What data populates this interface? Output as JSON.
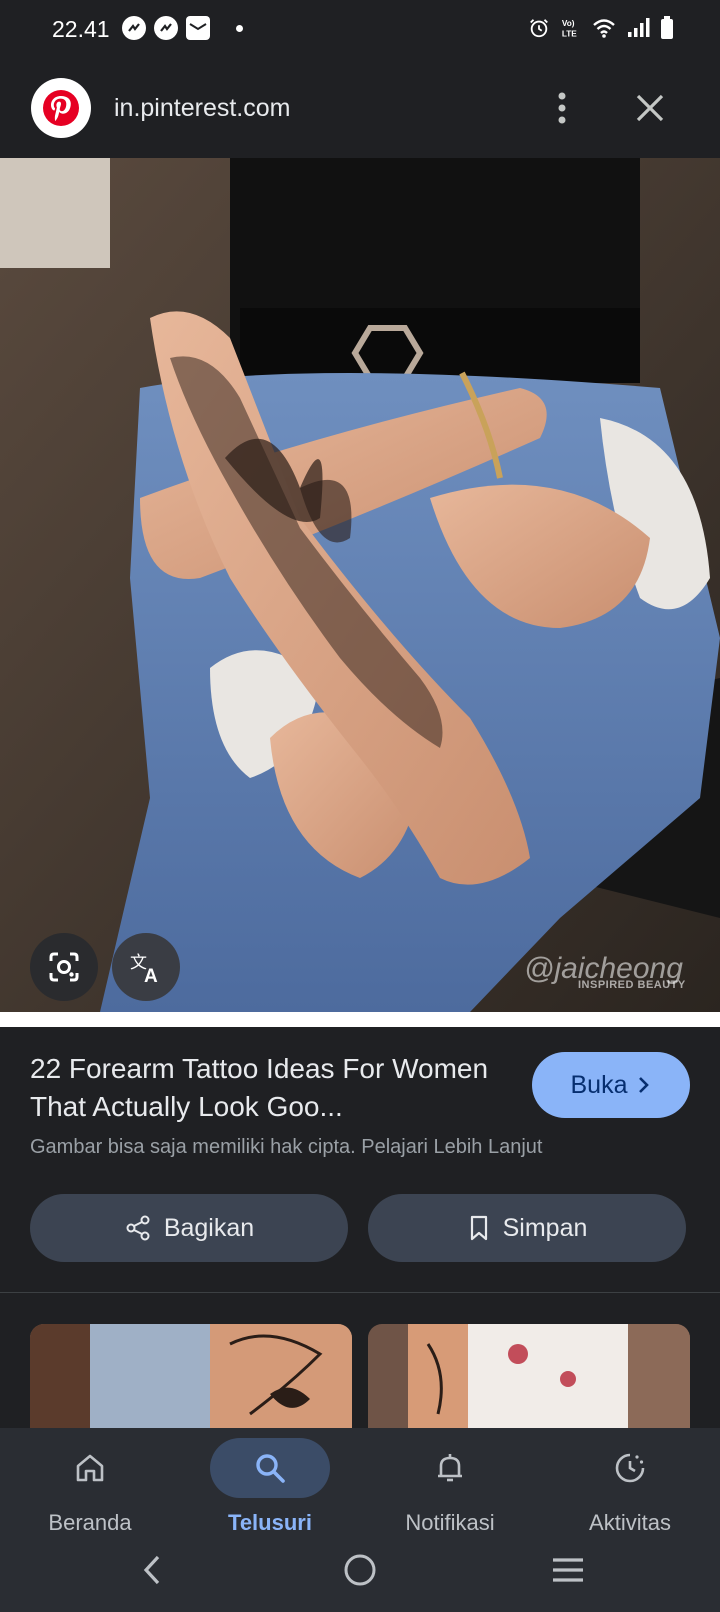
{
  "status_bar": {
    "time": "22.41",
    "left_icons": [
      "messenger-icon",
      "messenger-icon",
      "mail-icon",
      "dot-icon"
    ],
    "right_icons": [
      "alarm-icon",
      "volte-icon",
      "wifi-icon",
      "signal-icon",
      "battery-icon"
    ]
  },
  "browser": {
    "url": "in.pinterest.com",
    "favicon": "pinterest-icon",
    "menu_icon": "more-vert-icon",
    "close_icon": "close-icon"
  },
  "image": {
    "watermark": "@jaicheong",
    "watermark_sub": "INSPIRED BEAUTY",
    "lens_icon": "google-lens-icon",
    "translate_icon": "translate-icon"
  },
  "result": {
    "title": "22 Forearm Tattoo Ideas For Women That Actually Look Goo...",
    "open_label": "Buka",
    "copyright_notice": "Gambar bisa saja memiliki hak cipta. Pelajari Lebih Lanjut"
  },
  "actions": {
    "share_label": "Bagikan",
    "save_label": "Simpan"
  },
  "bottom_nav": {
    "items": [
      {
        "label": "Beranda",
        "icon": "home-icon"
      },
      {
        "label": "Telusuri",
        "icon": "search-icon",
        "active": true
      },
      {
        "label": "Notifikasi",
        "icon": "bell-icon"
      },
      {
        "label": "Aktivitas",
        "icon": "activity-icon"
      }
    ]
  },
  "colors": {
    "accent": "#8ab4f8",
    "background": "#1f2023",
    "pill": "#3c4452",
    "nav_background": "#2a2d33"
  }
}
